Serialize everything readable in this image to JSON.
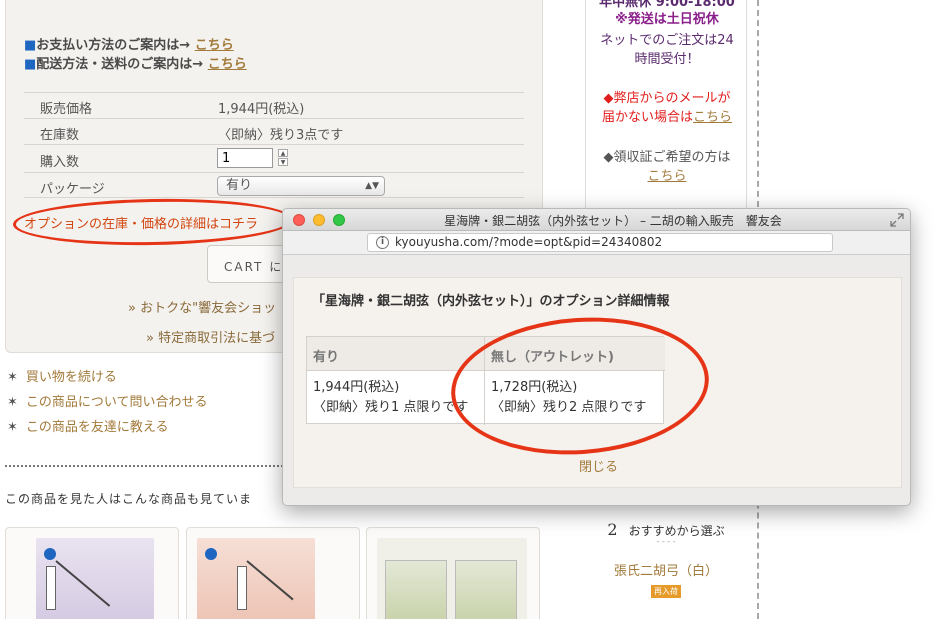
{
  "product_page": {
    "payment_info": {
      "prefix": "■",
      "label": "お支払い方法のご案内は→ ",
      "link": "こちら"
    },
    "shipping_info": {
      "prefix": "■",
      "label": "配送方法・送料のご案内は→ ",
      "link": "こちら"
    },
    "spec_rows": {
      "price": {
        "label": "販売価格",
        "value": "1,944円(税込)"
      },
      "stock": {
        "label": "在庫数",
        "value": "〈即納〉残り3点です"
      },
      "quantity": {
        "label": "購入数",
        "value": "1"
      },
      "package": {
        "label": "パッケージ",
        "value": "有り"
      }
    },
    "option_details_link": "オプションの在庫・価格の詳細はコチラ",
    "cart_button": "CART に",
    "promo_link": "» おトクな\"響友会ショッ",
    "law_link": "» 特定商取引法に基づ",
    "actions": {
      "continue": "買い物を続ける",
      "inquire": "この商品について問い合わせる",
      "tell_friend": "この商品を友達に教える"
    },
    "viewed_heading": "この商品を見た人はこんな商品も見ていま"
  },
  "sidebar": {
    "hours": "年中無休 9:00-18:00",
    "shipping_note": "※発送は土日祝休",
    "net_orders_line1": "ネットでのご注文は24",
    "net_orders_line2": "時間受付！",
    "mail_warning_line1": "◆弊店からのメールが",
    "mail_warning_line2": "届かない場合は",
    "mail_warning_link": "こちら",
    "receipt_line": "◆領収証ご希望の方は",
    "receipt_link": "こちら"
  },
  "recommend": {
    "number": "2",
    "title": "おすすめから選ぶ",
    "dots": "- - - -",
    "item": "張氏二胡弓（白）",
    "badge": "再入荷"
  },
  "popup": {
    "window_title": "星海牌・銀二胡弦（内外弦セット） – 二胡の輸入販売　響友会",
    "url": "kyouyusha.com/?mode=opt&pid=24340802",
    "heading": "「星海牌・銀二胡弦（内外弦セット）」のオプション詳細情報",
    "options": [
      {
        "name": "有り",
        "price": "1,944円(税込)",
        "stock": "〈即納〉残り1 点限りです"
      },
      {
        "name": "無し（アウトレット)",
        "price": "1,728円(税込)",
        "stock": "〈即納〉残り2 点限りです"
      }
    ],
    "close_label": "閉じる"
  },
  "colors": {
    "accent_link": "#a27a3a",
    "annotation_red": "#e63417",
    "option_link": "#d2450f",
    "info_blue": "#1f66c1"
  }
}
